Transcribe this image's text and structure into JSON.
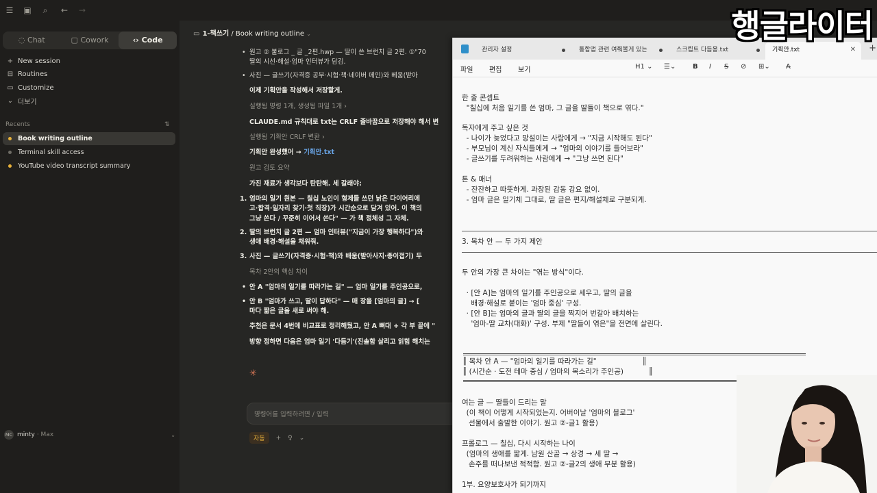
{
  "watermark": "행글라이터",
  "sidebar": {
    "tabs": [
      "Chat",
      "Cowork",
      "Code"
    ],
    "actions": [
      "New session",
      "Routines",
      "Customize",
      "더보기"
    ],
    "recents_label": "Recents",
    "recents": [
      "Book writing outline",
      "Terminal skill access",
      "YouTube video transcript summary"
    ],
    "user": {
      "initials": "MC",
      "name": "minty",
      "plan": "· Max"
    }
  },
  "main": {
    "breadcrumb_project": "1-책쓰기",
    "breadcrumb_sep": " / ",
    "breadcrumb_title": "Book writing outline",
    "lines": [
      "원고 ② 불로그 _ 글 _2편.hwp — 딸이 쓴 브런치 글 2편. ①\"70",
      "딸의 시선·해설·엄마 인터뷰가 담김.",
      "사진 — 글쓰기(자격증 공부·시험·책·네이버 메인)와 베움(받아",
      "이제 기획안을 작성해서 저장할게.",
      "실행됨 명령 1개, 생성됨 파일 1개  ›",
      "CLAUDE.md 규칙대로 txt는 CRLF 줄바꿈으로 저장해야 해서 변",
      "실행됨 기획안 CRLF 변환  ›",
      "기획안 완성했어 → ",
      "기획안.txt",
      "원고 검토 요약",
      "가진 재료가 생각보다 탄탄해. 세 갈래야:",
      "엄마의 일기 원본 — 칠십 노인이 형제들 쓰던 낡은 다이어리에",
      "고·합격·일자리 찾기·첫 직장)가 시간순으로 담겨 있어. 이 책의",
      "그냥 쓴다 / 꾸준히 이어서 쓴다\" — 가 책 정체성 그 자체.",
      "딸의 브런치 글 2편 — 엄마 인터뷰(\"지금이 가장 행복하다\")와",
      "생애 배경·해설을 채워줘.",
      "사진 — 글쓰기(자격증·시험·책)와 배움(받아사지·종이접기) 두",
      "목차 2안의 핵심 차이",
      "안 A \"엄마의 일기를 따라가는 길\" — 엄마 일기를 주인공으로,",
      "안 B \"엄마가 쓰고, 딸이 답하다\" — 매 장을 [엄마의 글] → [",
      "마다 짧은 글을 새로 써야 해.",
      "추천은 문서 4번에 비교표로 정리해뒀고, 안 A 뼈대 + 각 부 끝에 \"",
      "방향 정하면 다음은 엄마 일기 '다듬기'(진솔함 살리고 읽힘 해치는"
    ],
    "input_placeholder": "명령어를 입력하려면 / 입력",
    "mode_chip": "자동"
  },
  "notepad": {
    "tabs": [
      "관리자 설정",
      "통합앱 관련 여쭤볼게 있는",
      "스크립트 다듬용.txt",
      "기획안.txt"
    ],
    "menu": [
      "파일",
      "편집",
      "보기"
    ],
    "heading_selector": "H1",
    "lines": [
      "한 줄 콘셉트",
      "  \"칠십에 처음 일기를 쓴 엄마, 그 글을 딸들이 책으로 엮다.\"",
      "독자에게 주고 싶은 것",
      "  - 나이가 늦었다고 망설이는 사람에게 → \"지금 시작해도 된다\"",
      "  - 부모님이 계신 자식들에게 → \"엄마의 이야기를 들어보라\"",
      "  - 글쓰기를 두려워하는 사람에게 → \"그냥 쓰면 된다\"",
      "톤 & 매너",
      "  - 잔잔하고 따뜻하게. 과장된 감동 강요 없이.",
      "  - 엄마 글은 일기체 그대로, 딸 글은 편지/해설체로 구분되게.",
      "3. 목차 안 — 두 가지 제안",
      "두 안의 가장 큰 차이는 \"엮는 방식\"이다.",
      "  · [안 A]는 엄마의 일기를 주인공으로 세우고, 딸의 글을",
      "    배경·해설로 붙이는 '엄마 중심' 구성.",
      "  · [안 B]는 엄마의 글과 딸의 글을 짝지어 번갈아 배치하는",
      "    '엄마-딸 교차(대화)' 구성. 부제 \"딸들이 엮은\"을 전면에 살린다.",
      "║ 목차 안 A — \"엄마의 일기를 따라가는 길\"                    ║",
      "║ (시간순 · 도전 테마 중심 / 엄마의 목소리가 주인공)           ║",
      "여는 글 — 딸들이 드리는 말",
      "  (이 책이 어떻게 시작되었는지. 어버이날 '엄마의 블로그'",
      "   선물에서 출발한 이야기. 원고 ②-글1 활용)",
      "프롤로그 — 칠십, 다시 시작하는 나이",
      "  (엄마의 생애를 짧게. 남원 산골 → 상경 → 세 딸 →",
      "   손주를 떠나보낸 적적함. 원고 ②-글2의 생애 부분 활용)",
      "1부. 요양보호사가 되기까지"
    ]
  }
}
